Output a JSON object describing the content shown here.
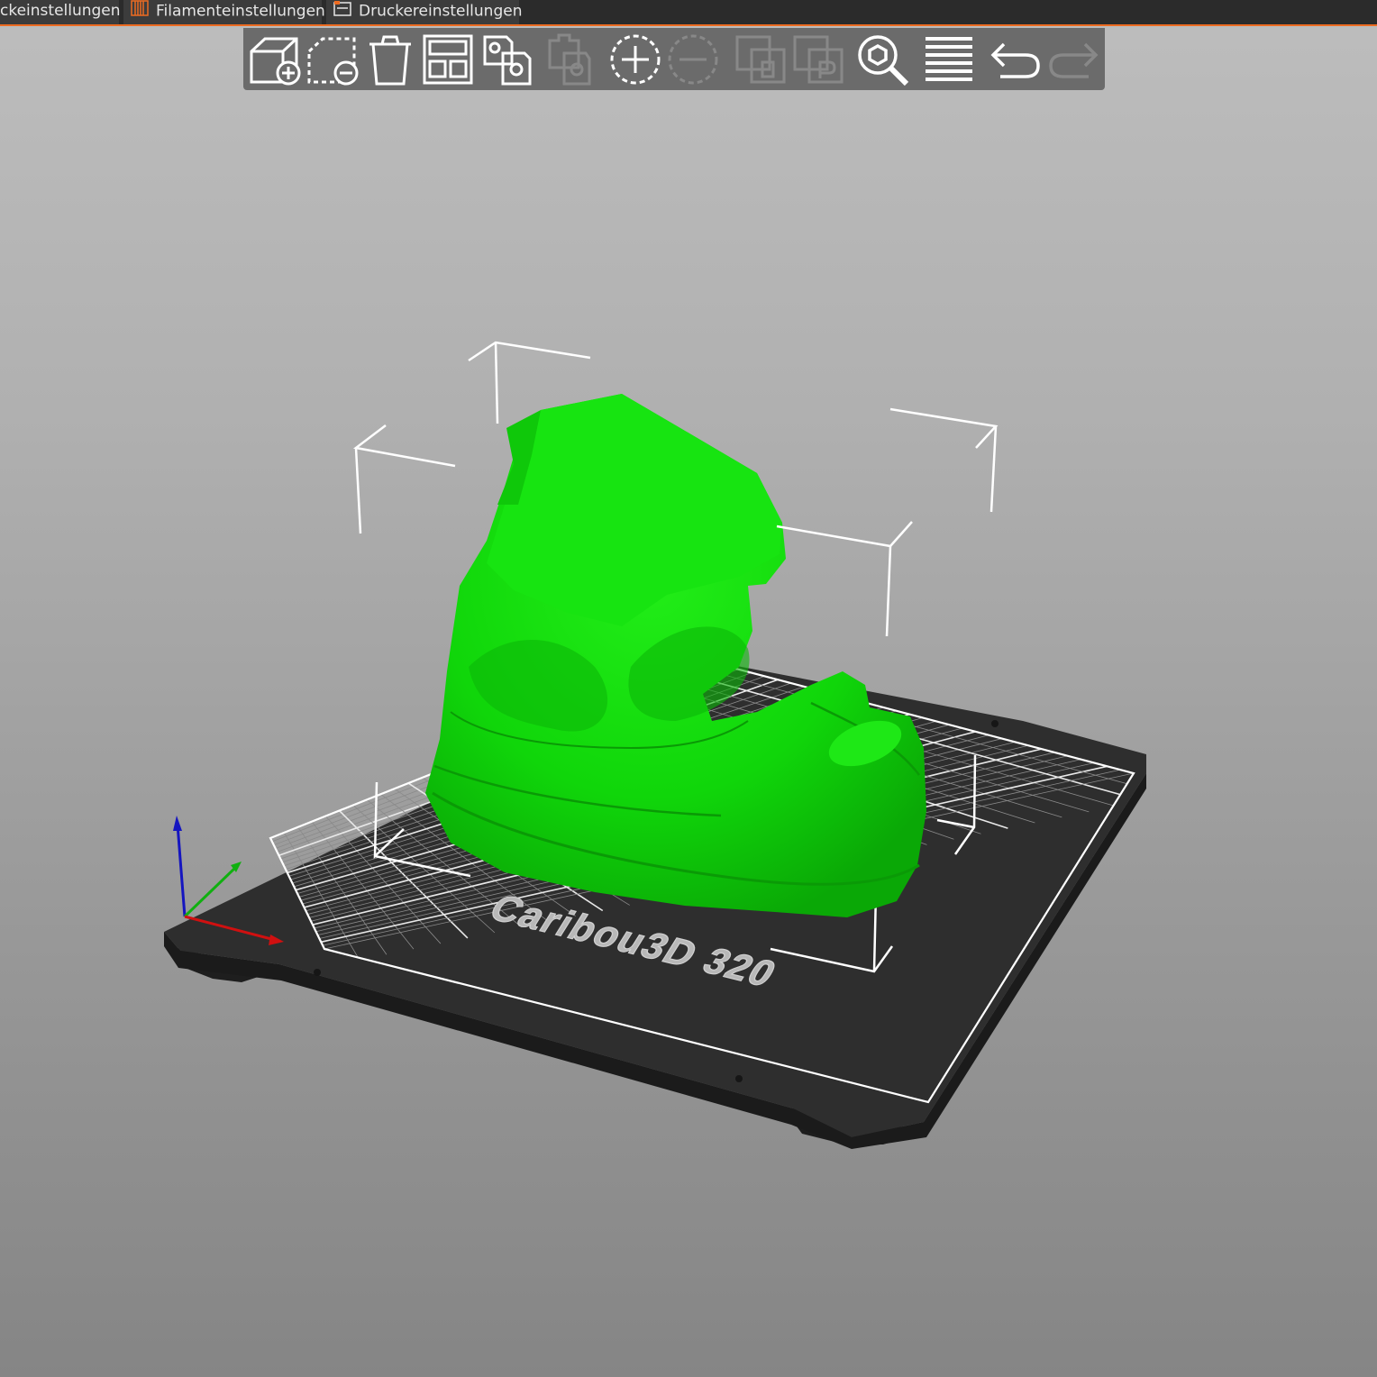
{
  "window": {
    "tabs": [
      {
        "label": "ckeinstellungen",
        "icon": "print-settings-icon"
      },
      {
        "label": "Filamenteinstellungen",
        "icon": "filament-spool-icon"
      },
      {
        "label": "Druckereinstellungen",
        "icon": "printer-icon"
      }
    ],
    "accent_color": "#ed6b21"
  },
  "toolbar": {
    "items": [
      {
        "icon": "add-object-icon",
        "enabled": true
      },
      {
        "icon": "remove-object-icon",
        "enabled": true
      },
      {
        "icon": "delete-all-icon",
        "enabled": true
      },
      {
        "icon": "arrange-icon",
        "enabled": true
      },
      {
        "icon": "copy-icon",
        "enabled": true
      },
      {
        "icon": "paste-icon",
        "enabled": false
      },
      {
        "icon": "add-instance-icon",
        "enabled": true
      },
      {
        "icon": "remove-instance-icon",
        "enabled": false
      },
      {
        "icon": "split-to-objects-icon",
        "enabled": false
      },
      {
        "icon": "split-to-parts-icon",
        "enabled": false
      },
      {
        "icon": "search-icon",
        "enabled": true
      },
      {
        "icon": "layers-editing-icon",
        "enabled": true
      },
      {
        "icon": "undo-icon",
        "enabled": true
      },
      {
        "icon": "redo-icon",
        "enabled": false
      }
    ]
  },
  "viewport": {
    "bed_label": "Caribou3D 320",
    "model_color": "#11dd0a",
    "bed_color": "#2e2e2e"
  }
}
